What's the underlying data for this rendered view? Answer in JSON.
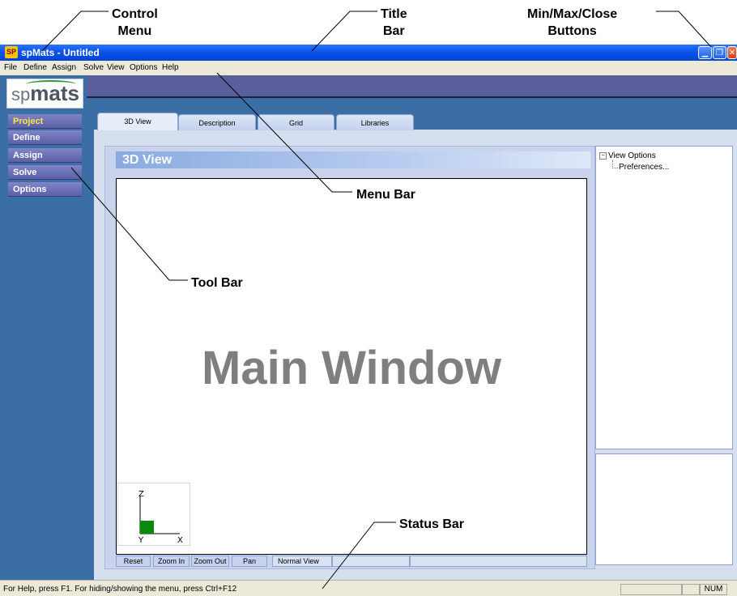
{
  "annotations": {
    "control_menu": [
      "Control",
      "Menu"
    ],
    "title_bar": [
      "Title",
      "Bar"
    ],
    "window_buttons": [
      "Min/Max/Close",
      "Buttons"
    ],
    "menu_bar": "Menu Bar",
    "tool_bar": "Tool Bar",
    "status_bar": "Status Bar",
    "main_window": "Main Window"
  },
  "window": {
    "title": "spMats - Untitled",
    "app_icon_text": "SP",
    "buttons": [
      "minimize-icon",
      "restore-icon",
      "close-icon"
    ]
  },
  "menu": [
    "File",
    "Define",
    "Assign",
    "Solve",
    "View",
    "Options",
    "Help"
  ],
  "logo": {
    "prefix": "sp",
    "name": "mats"
  },
  "toolbar": [
    {
      "label": "Project",
      "active": true
    },
    {
      "label": "Define",
      "active": false
    },
    {
      "label": "Assign",
      "active": false
    },
    {
      "label": "Solve",
      "active": false
    },
    {
      "label": "Options",
      "active": false
    }
  ],
  "tabs": [
    {
      "label": "3D View",
      "active": true
    },
    {
      "label": "Description",
      "active": false
    },
    {
      "label": "Grid",
      "active": false
    },
    {
      "label": "Libraries",
      "active": false
    }
  ],
  "view": {
    "title": "3D View",
    "axes": {
      "z": "Z",
      "y": "Y",
      "x": "X"
    },
    "buttons": [
      "Reset",
      "Zoom In",
      "Zoom Out",
      "Pan"
    ],
    "mode": "Normal View"
  },
  "tree": {
    "root": "View Options",
    "toggle": "−",
    "child": "Preferences..."
  },
  "status": {
    "help_text": "For Help, press F1. For hiding/showing the menu, press Ctrl+F12",
    "num": "NUM"
  },
  "colors": {
    "title_bar": "#0a54e6",
    "workspace": "#3a6ea5",
    "toolbar_button": "#6a70b8",
    "active_label": "#ffe640",
    "main_window_text": "#7f7f7f"
  }
}
